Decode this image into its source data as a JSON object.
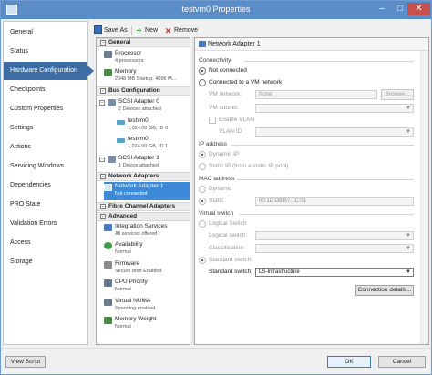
{
  "window": {
    "title": "testvm0 Properties"
  },
  "nav": {
    "items": [
      {
        "label": "General"
      },
      {
        "label": "Status"
      },
      {
        "label": "Hardware Configuration"
      },
      {
        "label": "Checkpoints"
      },
      {
        "label": "Custom Properties"
      },
      {
        "label": "Settings"
      },
      {
        "label": "Actions"
      },
      {
        "label": "Servicing Windows"
      },
      {
        "label": "Dependencies"
      },
      {
        "label": "PRO State"
      },
      {
        "label": "Validation Errors"
      },
      {
        "label": "Access"
      },
      {
        "label": "Storage"
      }
    ],
    "selected": "Hardware Configuration"
  },
  "toolbar": {
    "save": "Save As",
    "new": "New",
    "remove": "Remove"
  },
  "tree": {
    "sections": {
      "general": "General",
      "bus": "Bus Configuration",
      "network": "Network Adapters",
      "fibre": "Fibre Channel Adapters",
      "advanced": "Advanced"
    },
    "items": {
      "processor": {
        "title": "Processor",
        "sub": "4 processors"
      },
      "memory": {
        "title": "Memory",
        "sub": "2048 MB Startup, 4096 M..."
      },
      "scsi0": {
        "title": "SCSI Adapter 0",
        "sub": "2 Devices attached"
      },
      "disk1": {
        "title": "testvm0",
        "sub": "1,024.00 GB, ID 0"
      },
      "disk2": {
        "title": "testvm0",
        "sub": "1,024.00 GB, ID 1"
      },
      "scsi1": {
        "title": "SCSI Adapter 1",
        "sub": "1 Device attached"
      },
      "nic1": {
        "title": "Network Adapter 1",
        "sub": "Not connected"
      },
      "integration": {
        "title": "Integration Services",
        "sub": "All services offered"
      },
      "availability": {
        "title": "Availability",
        "sub": "Normal"
      },
      "firmware": {
        "title": "Firmware",
        "sub": "Secure boot Enabled"
      },
      "cpu_priority": {
        "title": "CPU Priority",
        "sub": "Normal"
      },
      "numa": {
        "title": "Virtual NUMA",
        "sub": "Spanning enabled"
      },
      "mem_weight": {
        "title": "Memory Weight",
        "sub": "Normal"
      }
    }
  },
  "panel": {
    "header": "Network Adapter 1",
    "connectivity": {
      "label": "Connectivity",
      "not_connected": "Not connected",
      "connected_vm": "Connected to a VM network",
      "vm_network_label": "VM network:",
      "vm_network_value": "None",
      "browse": "Browse...",
      "vm_subnet_label": "VM subnet:",
      "enable_vlan": "Enable VLAN",
      "vlan_id_label": "VLAN ID:"
    },
    "ip": {
      "label": "IP address",
      "dynamic": "Dynamic IP",
      "static": "Static IP (from a static IP pool)"
    },
    "mac": {
      "label": "MAC address",
      "dynamic": "Dynamic",
      "static": "Static",
      "static_value": "00:1D:D8:B7:1C:01"
    },
    "vswitch": {
      "label": "Virtual switch",
      "logical": "Logical Switch",
      "logical_switch_label": "Logical switch:",
      "classification_label": "Classification:",
      "standard": "Standard switch",
      "standard_switch_label": "Standard switch:",
      "standard_switch_value": "LS-Infrastructure",
      "connection_details": "Connection details..."
    }
  },
  "footer": {
    "view_script": "View Script",
    "ok": "OK",
    "cancel": "Cancel"
  }
}
